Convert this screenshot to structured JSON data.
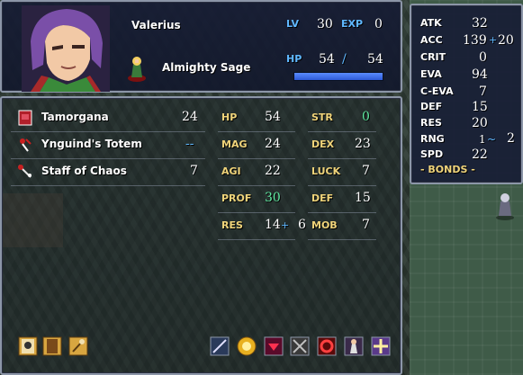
{
  "unit": {
    "name": "Valerius",
    "class": "Almighty Sage",
    "lv_label": "LV",
    "lv": "30",
    "exp_label": "EXP",
    "exp": "0",
    "hp_label": "HP",
    "hp_current": "54",
    "hp_sep": "/",
    "hp_max": "54",
    "hp_fraction": 1.0
  },
  "items": [
    {
      "name": "Tamorgana",
      "uses": "24",
      "icon": "red-tome-icon"
    },
    {
      "name": "Ynguind's Totem",
      "uses": "--",
      "icon": "totem-icon"
    },
    {
      "name": "Staff of Chaos",
      "uses": "7",
      "icon": "staff-icon"
    }
  ],
  "stats": {
    "hp": {
      "label": "HP",
      "value": "54"
    },
    "mag": {
      "label": "MAG",
      "value": "24"
    },
    "agi": {
      "label": "AGI",
      "value": "22"
    },
    "prof": {
      "label": "PROF",
      "value": "30"
    },
    "res": {
      "label": "RES",
      "value": "14",
      "plus": "+",
      "bonus": "6"
    },
    "str": {
      "label": "STR",
      "value": "0"
    },
    "dex": {
      "label": "DEX",
      "value": "23"
    },
    "luck": {
      "label": "LUCK",
      "value": "7"
    },
    "def": {
      "label": "DEF",
      "value": "15"
    },
    "mob": {
      "label": "MOB",
      "value": "7"
    }
  },
  "combat": {
    "atk": {
      "label": "ATK",
      "value": "32"
    },
    "acc": {
      "label": "ACC",
      "value": "139",
      "plus": "+",
      "bonus": "20"
    },
    "crit": {
      "label": "CRIT",
      "value": "0"
    },
    "eva": {
      "label": "EVA",
      "value": "94"
    },
    "ceva": {
      "label": "C-EVA",
      "value": "7"
    },
    "def": {
      "label": "DEF",
      "value": "15"
    },
    "res": {
      "label": "RES",
      "value": "20"
    },
    "rng": {
      "label": "RNG",
      "min": "1",
      "tilde": "~",
      "max": "2"
    },
    "spd": {
      "label": "SPD",
      "value": "22"
    },
    "bonds": "- BONDS -"
  },
  "colors": {
    "panel_border": "#8c96a8",
    "label_gold": "#f0d47a",
    "label_blue": "#5fb8ff",
    "value_green": "#5fe8a0",
    "hp_bar": "#3a6cf0"
  },
  "bottom_icons": [
    "skull-book-icon",
    "tome-icon",
    "staff-rank-icon",
    "staff-skill-icon",
    "gold-emblem-icon",
    "demon-face-icon",
    "crossed-swords-icon",
    "red-ring-icon",
    "robed-figure-icon",
    "holy-cross-icon"
  ]
}
